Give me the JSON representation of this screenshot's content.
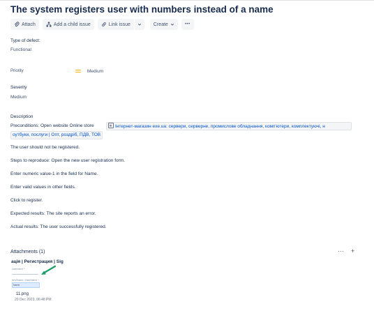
{
  "issue": {
    "title": "The system registers user with numbers instead of a name"
  },
  "toolbar": {
    "attach_label": "Attach",
    "add_child_label": "Add a child issue",
    "link_issue_label": "Link issue",
    "create_label": "Create",
    "more_label": "•••"
  },
  "fields": {
    "type_of_defect": {
      "label": "Type of defect:",
      "value": "Functional"
    },
    "priority": {
      "label": "Priority",
      "value": "Medium",
      "icon": "priority-medium-icon",
      "color": "#ffab00"
    },
    "severity": {
      "label": "Severity",
      "value": "Medium"
    }
  },
  "description": {
    "label": "Description",
    "preconditions_prefix": "Preconditions:  Open website Online store",
    "link_text_1": "Інтернет-магазин exe.ua: сервери, серверне, промислове обладнання, комп'ютери, комплектуючі, н",
    "link_text_2": "оутбуки, послуги | Опт, роздріб, ПДВ, ТОВ",
    "lines": [
      "The user should not be registered.",
      "Steps to reproduce: Open the new user registration form.",
      "Enter numeric value-1 in the field for Name.",
      "Enter valid values in other fields.",
      "Click to register.",
      "Expected results: The site reports an error.",
      "Actual results: The user successfully registered."
    ]
  },
  "attachments": {
    "title": "Attachments (1)",
    "more_label": "···",
    "add_label": "+",
    "items": [
      {
        "thumb_title": "ація | Регистрация | Sig",
        "thumb_label_1": "Username *",
        "thumb_label_2": "Ім'я/Name / Имя/Name *",
        "thumb_value": "Name",
        "arrow_color": "#1f9e6a",
        "file_name": "11.png",
        "date": "20 Dec 2023, 06:48 PM"
      }
    ]
  }
}
